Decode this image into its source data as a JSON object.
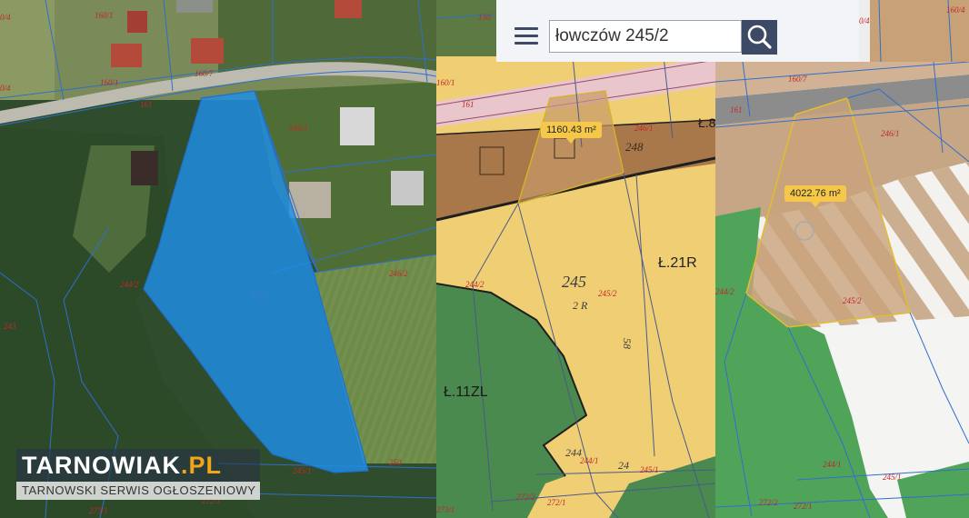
{
  "search": {
    "value": "łowczów 245/2"
  },
  "icons": {
    "menu": "hamburger-menu-icon",
    "search": "magnifier-icon"
  },
  "area_labels": {
    "plan": "1160.43 m²",
    "study": "4022.76 m²"
  },
  "logo": {
    "name_main": "TARNOWIAK",
    "name_suffix": ".PL",
    "subtitle": "TARNOWSKI SERWIS OGŁOSZENIOWY"
  },
  "parcels": {
    "p160_1": "160/1",
    "p160_7": "160/7",
    "p160_4": "160/4",
    "p0_4": "0/4",
    "p161": "161",
    "p246_1": "246/1",
    "p246_2": "246/2",
    "p245_2": "245/2",
    "p244_2": "244/2",
    "p244_1": "244/1",
    "p243": "243",
    "p245_1": "245/1",
    "p250": "250",
    "p272_1": "272/1",
    "p272_2": "272/2",
    "p273_1": "273/1",
    "p130": "130"
  },
  "zones": {
    "z1": "Ł.21R",
    "z2": "Ł.11ZL",
    "z3": "Ł.8"
  },
  "plan_text": {
    "n245": "245",
    "n2R": "2 R",
    "n248": "248",
    "n244": "244",
    "n24": "24",
    "n58": "58",
    "n160_1": "160/1"
  },
  "colors": {
    "selection_fill": "#1e8fe8",
    "tag_fill": "#f5c84a",
    "forest_green": "#4a8a4e",
    "agri_yellow": "#f0cf74",
    "built_brown": "#a8784a"
  }
}
